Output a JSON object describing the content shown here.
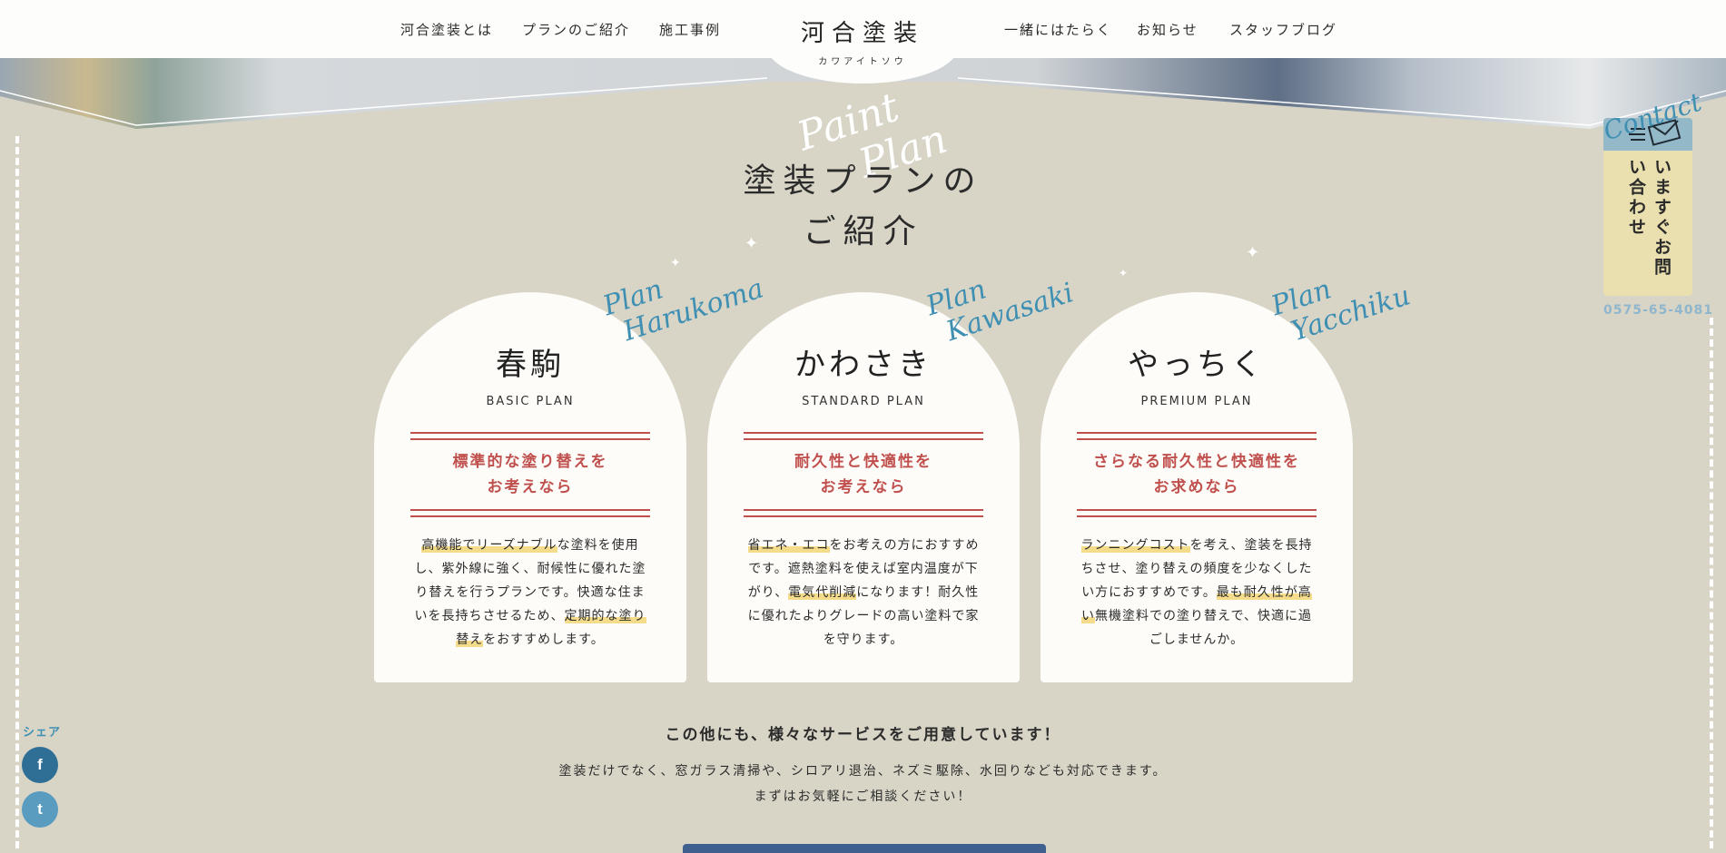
{
  "header": {
    "nav_left": [
      "河合塗装とは",
      "プランのご紹介",
      "施工事例"
    ],
    "logo_main": "河合塗装",
    "logo_sub": "カワアイトソウ",
    "nav_right": [
      "一緒にはたらく",
      "お知らせ",
      "スタッフブログ"
    ]
  },
  "section": {
    "script_1": "Paint",
    "script_2": "Plan",
    "title_line1": "塗装プランの",
    "title_line2": "ご紹介"
  },
  "plans": [
    {
      "script_1": "Plan",
      "script_2": "Harukoma",
      "name": "春駒",
      "plan_label": "BASIC PLAN",
      "tag_line1": "標準的な塗り替えを",
      "tag_line2": "お考えなら",
      "body": [
        {
          "text": "高機能でリーズナブル",
          "hl": true
        },
        {
          "text": "な塗料を使用し、紫外線に強く、耐候性に優れた塗り替えを行うプランです。快適な住まいを長持ちさせるため、",
          "hl": false
        },
        {
          "text": "定期的な塗り替え",
          "hl": true
        },
        {
          "text": "をおすすめします。",
          "hl": false
        }
      ]
    },
    {
      "script_1": "Plan",
      "script_2": "Kawasaki",
      "name": "かわさき",
      "plan_label": "STANDARD PLAN",
      "tag_line1": "耐久性と快適性を",
      "tag_line2": "お考えなら",
      "body": [
        {
          "text": "省エネ・エコ",
          "hl": true
        },
        {
          "text": "をお考えの方におすすめです。遮熱塗料を使えば室内温度が下がり、",
          "hl": false
        },
        {
          "text": "電気代削減",
          "hl": true
        },
        {
          "text": "になります！耐久性に優れたよりグレードの高い塗料で家を守ります。",
          "hl": false
        }
      ]
    },
    {
      "script_1": "Plan",
      "script_2": "Yacchiku",
      "name": "やっちく",
      "plan_label": "PREMIUM PLAN",
      "tag_line1": "さらなる耐久性と快適性を",
      "tag_line2": "お求めなら",
      "body": [
        {
          "text": "ランニングコスト",
          "hl": true
        },
        {
          "text": "を考え、塗装を長持ちさせ、塗り替えの頻度を少なくしたい方におすすめです。",
          "hl": false
        },
        {
          "text": "最も耐久性が高い",
          "hl": true
        },
        {
          "text": "無機塗料での塗り替えで、快適に過ごしませんか。",
          "hl": false
        }
      ]
    }
  ],
  "contact": {
    "script": "Contact",
    "text": "いますぐお問い合わせ",
    "phone": "0575-65-4081"
  },
  "share": {
    "label": "シェア",
    "facebook": "f",
    "twitter": "t"
  },
  "other": {
    "heading": "この他にも、様々なサービスをご用意しています！",
    "line1": "塗装だけでなく、窓ガラス清掃や、シロアリ退治、ネズミ駆除、水回りなども対応できます。",
    "line2": "まずはお気軽にご相談ください！"
  },
  "colors": {
    "accent_red": "#c0504d",
    "accent_blue": "#3f8fb3",
    "highlight": "#f4dc8a",
    "background": "#d8d5c7"
  }
}
